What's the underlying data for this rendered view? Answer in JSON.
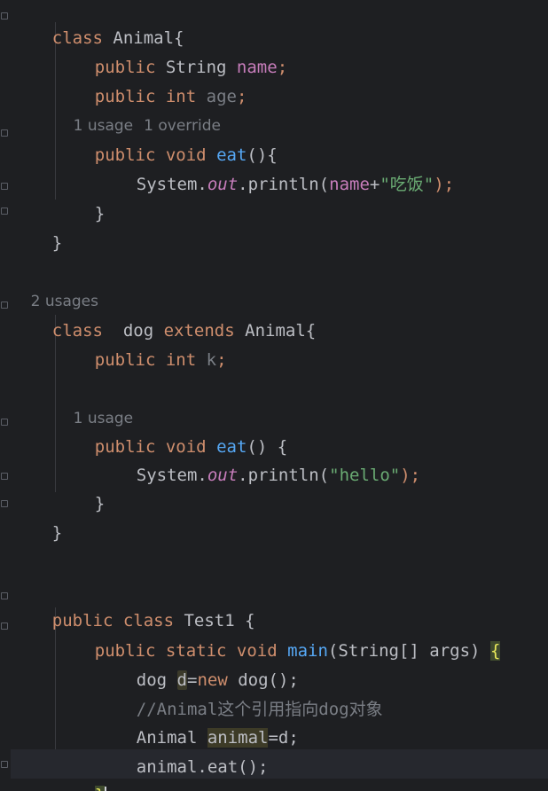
{
  "code": {
    "l1": {
      "kw1": "class",
      "name": " Animal{"
    },
    "l2": {
      "kw1": "public",
      "type": " String ",
      "field": "name",
      "end": ";"
    },
    "l3": {
      "kw1": "public",
      "kw2": " int",
      "sp": " ",
      "field": "age",
      "end": ";"
    },
    "h1": {
      "a": "1 usage",
      "b": "1 override"
    },
    "l4": {
      "kw1": "public",
      "kw2": " void",
      "sp": " ",
      "fn": "eat",
      "end": "(){"
    },
    "l5": {
      "obj": "System.",
      "out": "out",
      "call": ".println(",
      "field": "name",
      "plus": "+",
      "str": "\"吃饭\"",
      "end": ");"
    },
    "l6": {
      "text": "}"
    },
    "l7": {
      "text": "}"
    },
    "h2": {
      "a": "2 usages"
    },
    "l8": {
      "kw1": "class",
      "mid": "  dog ",
      "kw2": "extends",
      "end": " Animal{"
    },
    "l9": {
      "kw1": "public",
      "kw2": " int",
      "sp": " ",
      "field": "k",
      "end": ";"
    },
    "h3": {
      "a": "1 usage"
    },
    "l10": {
      "kw1": "public",
      "kw2": " void",
      "sp": " ",
      "fn": "eat",
      "end": "() {"
    },
    "l11": {
      "obj": "System.",
      "out": "out",
      "call": ".println(",
      "str": "\"hello\"",
      "end": ");"
    },
    "l12": {
      "text": "}"
    },
    "l13": {
      "text": "}"
    },
    "l14": {
      "kw1": "public",
      "kw2": " class",
      "end": " Test1 {"
    },
    "l15": {
      "kw1": "public",
      "kw2": " static",
      "kw3": " void",
      "sp": " ",
      "fn": "main",
      "end": "(String[] args) ",
      "brace": "{"
    },
    "l16": {
      "type": "dog ",
      "var": "d",
      "eq": "=",
      "kw": "new",
      "end": " dog();"
    },
    "l17": {
      "comment": "//Animal这个引用指向dog对象"
    },
    "l18": {
      "type": "Animal ",
      "var": "animal",
      "end": "=d;"
    },
    "l19": {
      "text": "animal.eat();"
    },
    "l20": {
      "brace": "}"
    }
  },
  "colors": {
    "background": "#1e1f22",
    "keyword": "#cf8e6d",
    "field": "#c77dbb",
    "function": "#56a8f5",
    "string": "#6aab73",
    "comment": "#7a7e85",
    "text": "#bcbec4"
  }
}
